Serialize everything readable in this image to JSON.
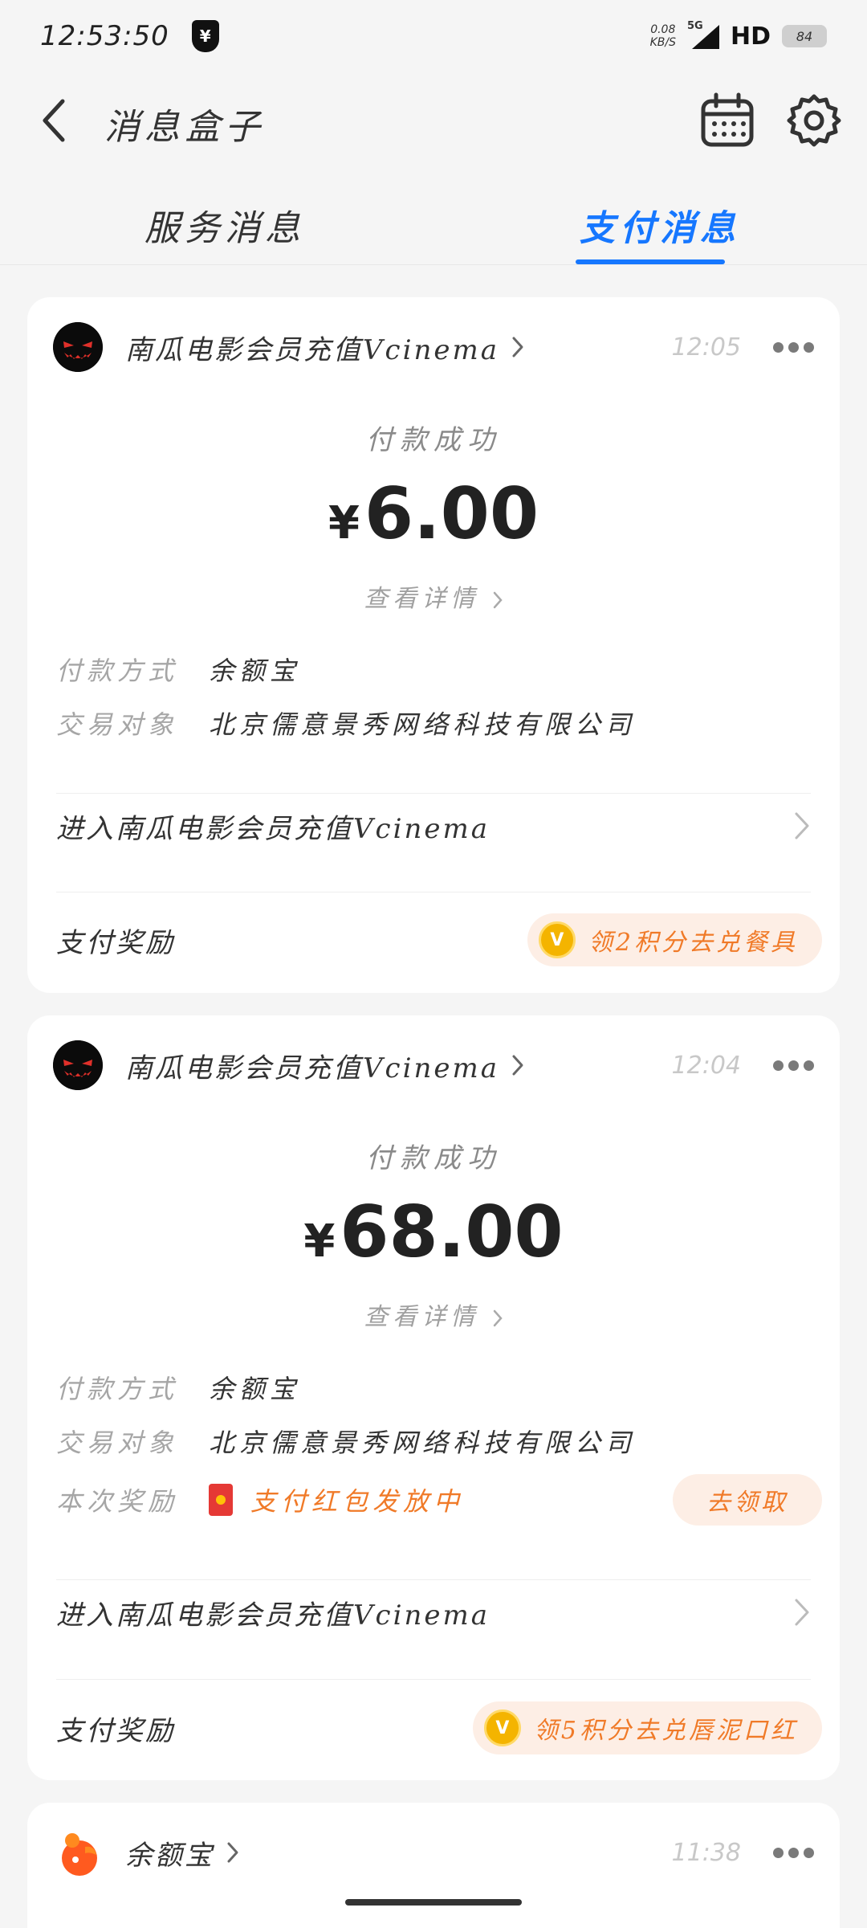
{
  "status_bar": {
    "time": "12:53:50",
    "shield_glyph": "¥",
    "net_speed_value": "0.08",
    "net_speed_unit": "KB/S",
    "network": "5G",
    "hd": "HD",
    "battery": "84"
  },
  "header": {
    "title": "消息盒子"
  },
  "tabs": [
    {
      "label": "服务消息",
      "active": false
    },
    {
      "label": "支付消息",
      "active": true
    }
  ],
  "cards": [
    {
      "merchant": "南瓜电影会员充值Vcinema",
      "time": "12:05",
      "status": "付款成功",
      "currency": "¥",
      "amount": "6.00",
      "detail_link": "查看详情",
      "details": [
        {
          "label": "付款方式",
          "value": "余额宝"
        },
        {
          "label": "交易对象",
          "value": "北京儒意景秀网络科技有限公司"
        }
      ],
      "enter_label": "进入南瓜电影会员充值Vcinema",
      "reward_label": "支付奖励",
      "reward_coin": "V",
      "reward_text": "领2积分去兑餐具"
    },
    {
      "merchant": "南瓜电影会员充值Vcinema",
      "time": "12:04",
      "status": "付款成功",
      "currency": "¥",
      "amount": "68.00",
      "detail_link": "查看详情",
      "details": [
        {
          "label": "付款方式",
          "value": "余额宝"
        },
        {
          "label": "交易对象",
          "value": "北京儒意景秀网络科技有限公司"
        }
      ],
      "bonus": {
        "label": "本次奖励",
        "value": "支付红包发放中",
        "button": "去领取"
      },
      "enter_label": "进入南瓜电影会员充值Vcinema",
      "reward_label": "支付奖励",
      "reward_coin": "V",
      "reward_text": "领5积分去兑唇泥口红"
    },
    {
      "merchant": "余额宝",
      "time": "11:38"
    }
  ],
  "colors": {
    "accent": "#1677ff",
    "orange": "#f07a28",
    "reward_bg": "#fdeee5"
  },
  "icons": [
    "back-icon",
    "calendar-icon",
    "gear-icon",
    "more-icon",
    "chevron-right-icon",
    "coin-icon",
    "red-packet-icon"
  ]
}
